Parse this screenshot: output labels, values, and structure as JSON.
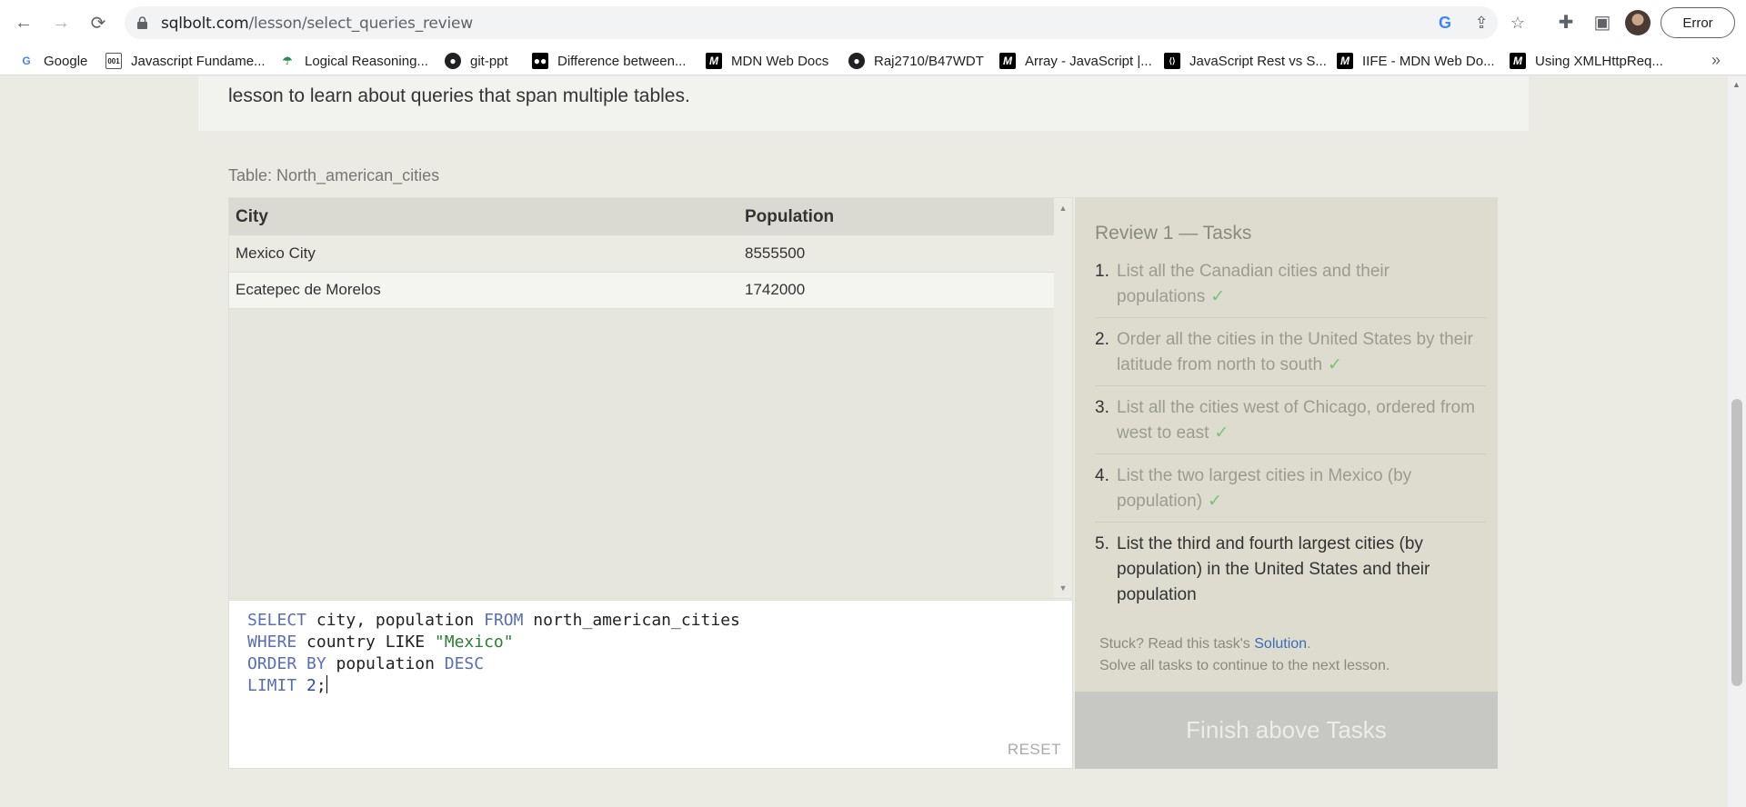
{
  "browser": {
    "url_host": "sqlbolt.com",
    "url_path": "/lesson/select_queries_review",
    "profile_status": "Error",
    "more_bookmarks": "»"
  },
  "bookmarks": [
    {
      "label": "Google",
      "icon": "google-icon"
    },
    {
      "label": "Javascript Fundame...",
      "icon": "doc-icon"
    },
    {
      "label": "Logical Reasoning...",
      "icon": "umbrella-icon"
    },
    {
      "label": "git-ppt",
      "icon": "github-icon"
    },
    {
      "label": "Difference between...",
      "icon": "medium-icon"
    },
    {
      "label": "MDN Web Docs",
      "icon": "mdn-icon"
    },
    {
      "label": "Raj2710/B47WDT",
      "icon": "github-icon"
    },
    {
      "label": "Array - JavaScript |...",
      "icon": "mdn-icon"
    },
    {
      "label": "JavaScript Rest vs S...",
      "icon": "code-icon"
    },
    {
      "label": "IIFE - MDN Web Do...",
      "icon": "mdn-icon"
    },
    {
      "label": "Using XMLHttpReq...",
      "icon": "mdn-icon"
    }
  ],
  "lesson": {
    "intro_text": "lesson to learn about queries that span multiple tables.",
    "table_caption": "Table: North_american_cities",
    "result_table": {
      "headers": [
        "City",
        "Population"
      ],
      "rows": [
        [
          "Mexico City",
          "8555500"
        ],
        [
          "Ecatepec de Morelos",
          "1742000"
        ]
      ]
    },
    "editor": {
      "lines": [
        [
          {
            "t": "SELECT",
            "c": "kw"
          },
          {
            "t": " city, population ",
            "c": ""
          },
          {
            "t": "FROM",
            "c": "kw"
          },
          {
            "t": " north_american_cities",
            "c": ""
          }
        ],
        [
          {
            "t": "WHERE",
            "c": "kw"
          },
          {
            "t": " country LIKE ",
            "c": ""
          },
          {
            "t": "\"Mexico\"",
            "c": "str"
          }
        ],
        [
          {
            "t": "ORDER BY",
            "c": "kw"
          },
          {
            "t": " population ",
            "c": ""
          },
          {
            "t": "DESC",
            "c": "kw"
          }
        ],
        [
          {
            "t": "LIMIT",
            "c": "kw"
          },
          {
            "t": " ",
            "c": ""
          },
          {
            "t": "2",
            "c": "num"
          },
          {
            "t": ";",
            "c": ""
          }
        ]
      ],
      "reset_label": "RESET"
    },
    "tasks": {
      "title": "Review 1 — Tasks",
      "items": [
        {
          "num": "1.",
          "text": "List all the Canadian cities and their populations",
          "done": true
        },
        {
          "num": "2.",
          "text": "Order all the cities in the United States by their latitude from north to south",
          "done": true
        },
        {
          "num": "3.",
          "text": "List all the cities west of Chicago, ordered from west to east",
          "done": true
        },
        {
          "num": "4.",
          "text": "List the two largest cities in Mexico (by population)",
          "done": true
        },
        {
          "num": "5.",
          "text": "List the third and fourth largest cities (by population) in the United States and their population",
          "done": false
        }
      ],
      "check_mark": "✓",
      "stuck_prefix": "Stuck? Read this task's ",
      "solution_link": "Solution",
      "stuck_suffix": ".",
      "continue_note": "Solve all tasks to continue to the next lesson."
    },
    "finish_button": "Finish above Tasks"
  }
}
